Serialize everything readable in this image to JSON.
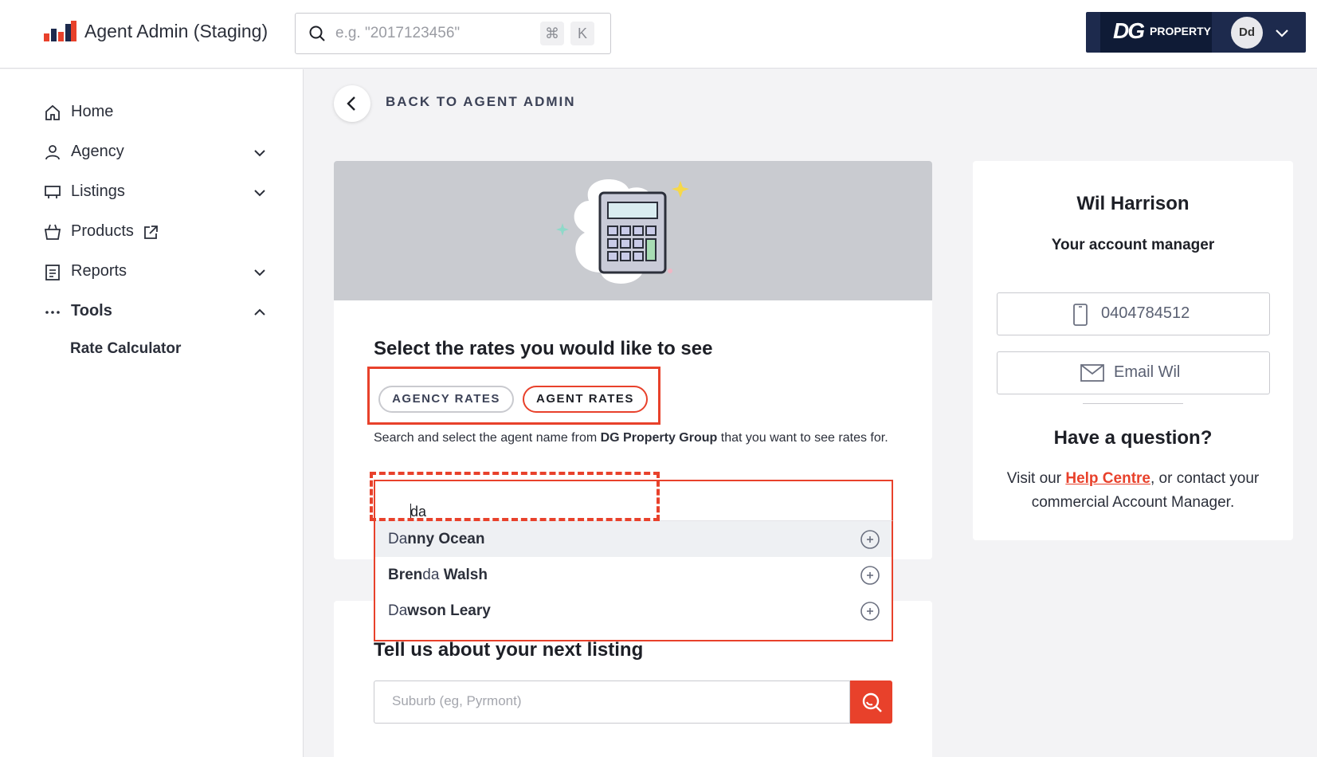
{
  "header": {
    "app_title": "Agent Admin (Staging)",
    "search_placeholder": "e.g. \"2017123456\"",
    "shortcut_cmd": "⌘",
    "shortcut_key": "K",
    "agency_logo_mark": "DG",
    "agency_logo_text": "PROPERTY",
    "avatar_initials": "Dd"
  },
  "sidebar": {
    "items": [
      {
        "label": "Home",
        "icon": "home-icon"
      },
      {
        "label": "Agency",
        "icon": "person-icon"
      },
      {
        "label": "Listings",
        "icon": "monitor-icon"
      },
      {
        "label": "Products",
        "icon": "basket-icon"
      },
      {
        "label": "Reports",
        "icon": "clipboard-icon"
      },
      {
        "label": "Tools",
        "icon": "dots-icon"
      }
    ],
    "sub_item": "Rate Calculator"
  },
  "back": {
    "label": "BACK TO AGENT ADMIN"
  },
  "rates_card": {
    "title": "Select the rates you would like to see",
    "toggle_agency": "AGENCY RATES",
    "toggle_agent": "AGENT RATES",
    "selected": "AGENT RATES",
    "desc_before": "Search and select the agent name from ",
    "desc_bold": "DG Property Group",
    "desc_after": " that you want to see rates for.",
    "search_value": "da"
  },
  "autocomplete": [
    {
      "match": "Da",
      "rest": "nny Ocean"
    },
    {
      "prefix": "Bren",
      "match": "da",
      "rest": " Walsh"
    },
    {
      "match": "Da",
      "rest": "wson Leary"
    }
  ],
  "listing_card": {
    "title": "Tell us about your next listing",
    "suburb_placeholder": "Suburb (eg, Pyrmont)"
  },
  "manager": {
    "name": "Wil Harrison",
    "role": "Your account manager",
    "phone": "0404784512",
    "email_label": "Email Wil",
    "question_title": "Have a question?",
    "question_before": "Visit our ",
    "help_link": "Help Centre",
    "question_after": ", or contact your commercial Account Manager."
  },
  "colors": {
    "accent": "#e8412b",
    "navy": "#1d2a4d"
  }
}
